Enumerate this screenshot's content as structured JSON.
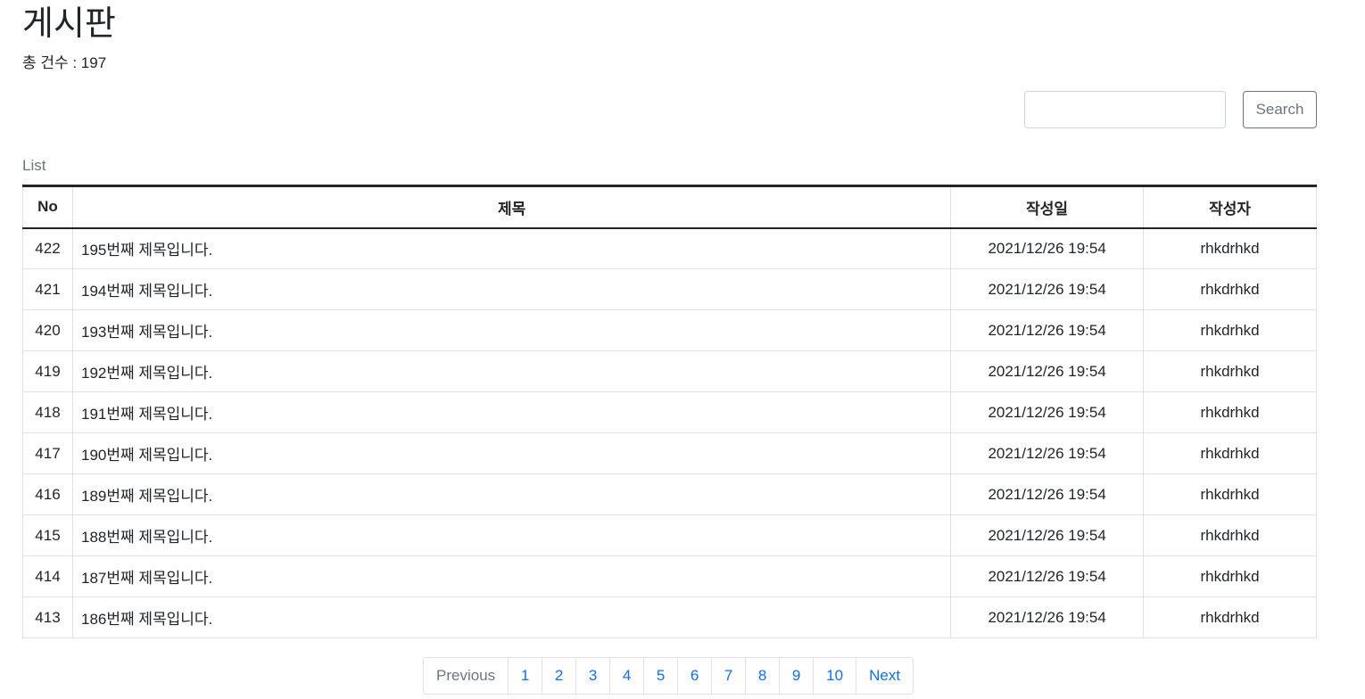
{
  "page": {
    "title": "게시판",
    "total_label": "총 건수 : 197"
  },
  "search": {
    "placeholder": "",
    "value": "",
    "button_label": "Search"
  },
  "list": {
    "caption": "List",
    "columns": [
      "No",
      "제목",
      "작성일",
      "작성자"
    ],
    "rows": [
      {
        "no": "422",
        "title": "195번째 제목입니다.",
        "date": "2021/12/26 19:54",
        "writer": "rhkdrhkd"
      },
      {
        "no": "421",
        "title": "194번째 제목입니다.",
        "date": "2021/12/26 19:54",
        "writer": "rhkdrhkd"
      },
      {
        "no": "420",
        "title": "193번째 제목입니다.",
        "date": "2021/12/26 19:54",
        "writer": "rhkdrhkd"
      },
      {
        "no": "419",
        "title": "192번째 제목입니다.",
        "date": "2021/12/26 19:54",
        "writer": "rhkdrhkd"
      },
      {
        "no": "418",
        "title": "191번째 제목입니다.",
        "date": "2021/12/26 19:54",
        "writer": "rhkdrhkd"
      },
      {
        "no": "417",
        "title": "190번째 제목입니다.",
        "date": "2021/12/26 19:54",
        "writer": "rhkdrhkd"
      },
      {
        "no": "416",
        "title": "189번째 제목입니다.",
        "date": "2021/12/26 19:54",
        "writer": "rhkdrhkd"
      },
      {
        "no": "415",
        "title": "188번째 제목입니다.",
        "date": "2021/12/26 19:54",
        "writer": "rhkdrhkd"
      },
      {
        "no": "414",
        "title": "187번째 제목입니다.",
        "date": "2021/12/26 19:54",
        "writer": "rhkdrhkd"
      },
      {
        "no": "413",
        "title": "186번째 제목입니다.",
        "date": "2021/12/26 19:54",
        "writer": "rhkdrhkd"
      }
    ]
  },
  "pagination": {
    "previous_label": "Previous",
    "pages": [
      "1",
      "2",
      "3",
      "4",
      "5",
      "6",
      "7",
      "8",
      "9",
      "10"
    ],
    "next_label": "Next"
  },
  "colors": {
    "link": "#0d6efd",
    "muted": "#6c757d",
    "text": "#212529",
    "border": "#dee2e6"
  }
}
